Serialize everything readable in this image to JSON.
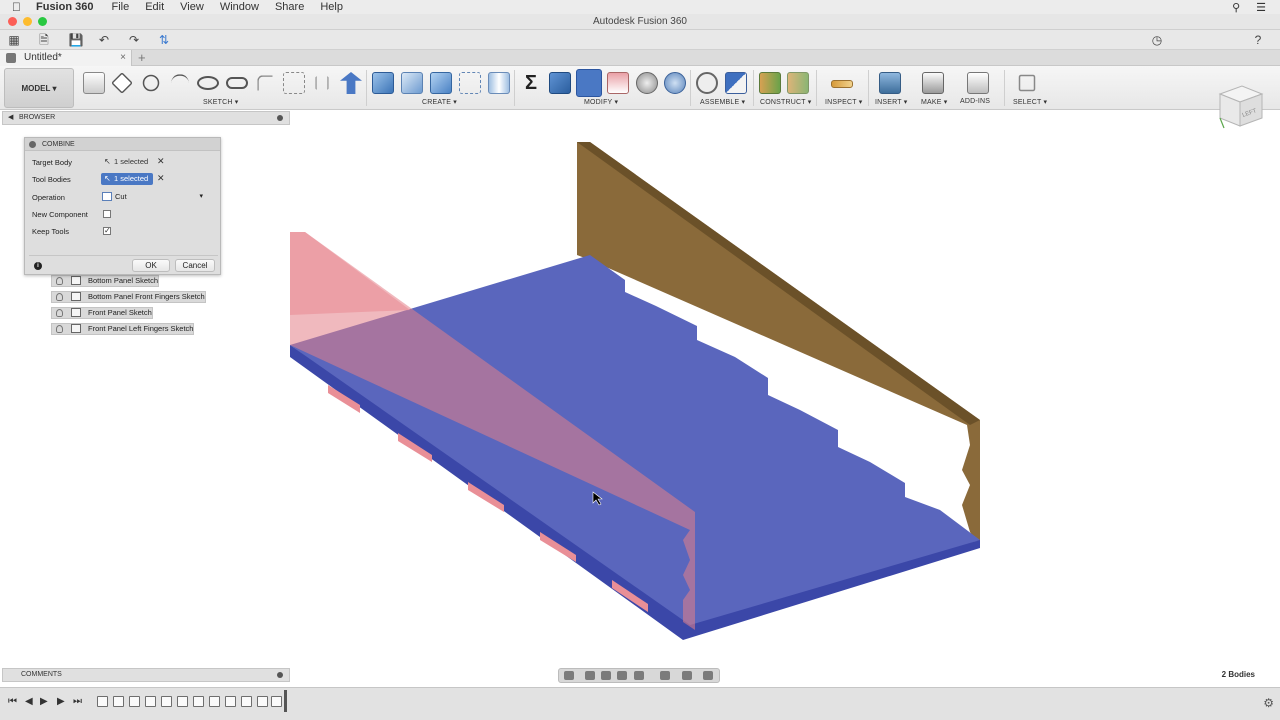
{
  "menubar": {
    "app_name": "Fusion 360",
    "items": [
      "File",
      "Edit",
      "View",
      "Window",
      "Share",
      "Help"
    ]
  },
  "window": {
    "title": "Autodesk Fusion 360"
  },
  "tab": {
    "label": "Untitled*"
  },
  "ribbon": {
    "workspace": "MODEL",
    "groups": [
      "SKETCH",
      "CREATE",
      "MODIFY",
      "ASSEMBLE",
      "CONSTRUCT",
      "INSPECT",
      "INSERT",
      "MAKE",
      "ADD-INS",
      "SELECT"
    ]
  },
  "browser": {
    "title": "BROWSER"
  },
  "combine": {
    "title": "COMBINE",
    "target_body_label": "Target Body",
    "target_body_value": "1 selected",
    "tool_bodies_label": "Tool Bodies",
    "tool_bodies_value": "1 selected",
    "operation_label": "Operation",
    "operation_value": "Cut",
    "new_component_label": "New Component",
    "new_component_checked": false,
    "keep_tools_label": "Keep Tools",
    "keep_tools_checked": true,
    "ok_label": "OK",
    "cancel_label": "Cancel"
  },
  "sketches": [
    "Bottom Panel Sketch",
    "Bottom Panel Front Fingers Sketch",
    "Front Panel Sketch",
    "Front Panel Left Fingers Sketch"
  ],
  "viewcube": {
    "face_label": "LEFT"
  },
  "comments": {
    "title": "COMMENTS"
  },
  "status": {
    "bodies": "2 Bodies"
  },
  "colors": {
    "bottom_panel": "#5461b8",
    "front_panel": "#e98f97",
    "back_panel": "#8a6a3a",
    "selection": "#4a78c4"
  }
}
